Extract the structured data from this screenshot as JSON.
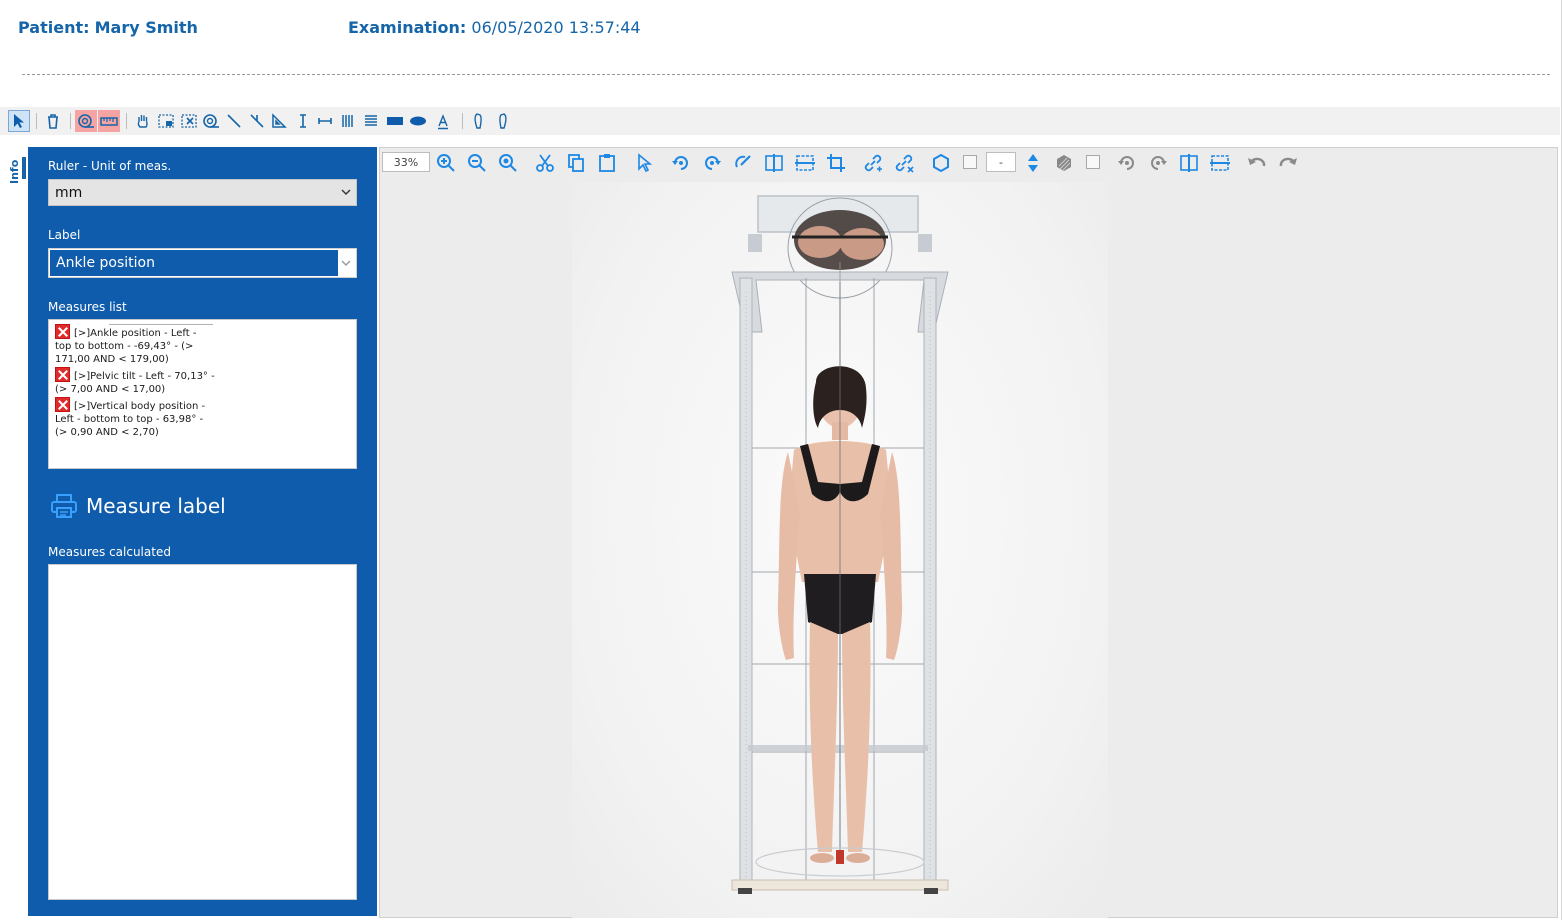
{
  "header": {
    "patient_label": "Patient:",
    "patient_name": "Mary Smith",
    "exam_label": "Examination:",
    "exam_datetime": "06/05/2020 13:57:44"
  },
  "side_tab": {
    "label": "Info"
  },
  "panel": {
    "ruler_label": "Ruler - Unit of meas.",
    "ruler_value": "mm",
    "label_label": "Label",
    "label_value": "Ankle position",
    "measures_list_label": "Measures list",
    "measures": [
      {
        "text": "[>]Ankle position - Left - top to bottom - -69,43° - (> 171,00 AND < 179,00)"
      },
      {
        "text": "[>]Pelvic tilt - Left - 70,13° - (> 7,00 AND < 17,00)"
      },
      {
        "text": "[>]Vertical body position - Left - bottom to top - 63,98° - (> 0,90 AND < 2,70)"
      }
    ],
    "print_label": "Measure label",
    "measures_calculated_label": "Measures calculated"
  },
  "viewer": {
    "zoom": "33%",
    "line_style": "-"
  },
  "colors": {
    "panel_blue": "#0f5cac",
    "accent_blue": "#1e88e5",
    "header_text": "#1565a8",
    "error_red": "#e12a2a"
  },
  "icons": {
    "top_toolbar": [
      "pointer-icon",
      "trash-icon",
      "spiral-ruler-icon",
      "ruler-icon",
      "hand-icon",
      "select-image-icon",
      "delete-selection-icon",
      "spiral-icon",
      "line-icon",
      "angle-line-icon",
      "set-square-icon",
      "vertical-measure-icon",
      "horizontal-measure-icon",
      "vertical-lines-icon",
      "horizontal-lines-icon",
      "rectangle-icon",
      "ellipse-icon",
      "text-icon",
      "left-foot-icon",
      "right-foot-icon"
    ],
    "viewer_toolbar": [
      "zoom-in-icon",
      "zoom-out-icon",
      "zoom-fit-icon",
      "cut-icon",
      "copy-icon",
      "paste-icon",
      "pointer-icon",
      "rotate-left-icon",
      "rotate-right-icon",
      "rotate-free-icon",
      "flip-horizontal-icon",
      "flip-vertical-icon",
      "crop-icon",
      "link-add-icon",
      "link-remove-icon",
      "hexagon-icon",
      "color-box-icon",
      "line-width-icon",
      "fill-pattern-icon",
      "fill-box-icon",
      "rotate-left-alt-icon",
      "rotate-right-alt-icon",
      "flip-horizontal-alt-icon",
      "flip-vertical-alt-icon",
      "undo-icon",
      "redo-icon"
    ]
  }
}
